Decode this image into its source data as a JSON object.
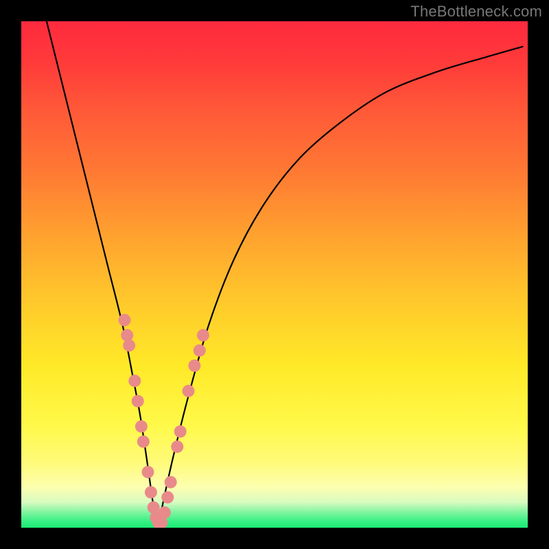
{
  "watermark": "TheBottleneck.com",
  "chart_data": {
    "type": "line",
    "title": "",
    "xlabel": "",
    "ylabel": "",
    "xlim": [
      0,
      100
    ],
    "ylim": [
      0,
      100
    ],
    "series": [
      {
        "name": "bottleneck-curve",
        "x": [
          5,
          8,
          11,
          14,
          17,
          20,
          22,
          23.5,
          25,
          26,
          27,
          28,
          30,
          33,
          37,
          42,
          48,
          55,
          63,
          72,
          82,
          92,
          99
        ],
        "y": [
          100,
          88,
          76,
          64,
          52,
          40,
          30,
          22,
          12,
          5,
          0,
          5,
          14,
          26,
          40,
          53,
          64,
          73,
          80,
          86,
          90,
          93,
          95
        ]
      }
    ],
    "markers": {
      "name": "highlighted-points",
      "color": "#e98a8a",
      "points": [
        {
          "x": 20.4,
          "y": 41.0
        },
        {
          "x": 20.9,
          "y": 38.0
        },
        {
          "x": 21.3,
          "y": 36.0
        },
        {
          "x": 22.4,
          "y": 29.0
        },
        {
          "x": 23.0,
          "y": 25.0
        },
        {
          "x": 23.7,
          "y": 20.0
        },
        {
          "x": 24.1,
          "y": 17.0
        },
        {
          "x": 25.0,
          "y": 11.0
        },
        {
          "x": 25.6,
          "y": 7.0
        },
        {
          "x": 26.1,
          "y": 4.0
        },
        {
          "x": 26.6,
          "y": 2.0
        },
        {
          "x": 27.1,
          "y": 1.0
        },
        {
          "x": 27.7,
          "y": 1.0
        },
        {
          "x": 28.3,
          "y": 3.0
        },
        {
          "x": 28.9,
          "y": 6.0
        },
        {
          "x": 29.5,
          "y": 9.0
        },
        {
          "x": 30.8,
          "y": 16.0
        },
        {
          "x": 31.4,
          "y": 19.0
        },
        {
          "x": 33.0,
          "y": 27.0
        },
        {
          "x": 34.2,
          "y": 32.0
        },
        {
          "x": 35.2,
          "y": 35.0
        },
        {
          "x": 35.9,
          "y": 38.0
        }
      ]
    },
    "grid": false,
    "legend": false
  }
}
